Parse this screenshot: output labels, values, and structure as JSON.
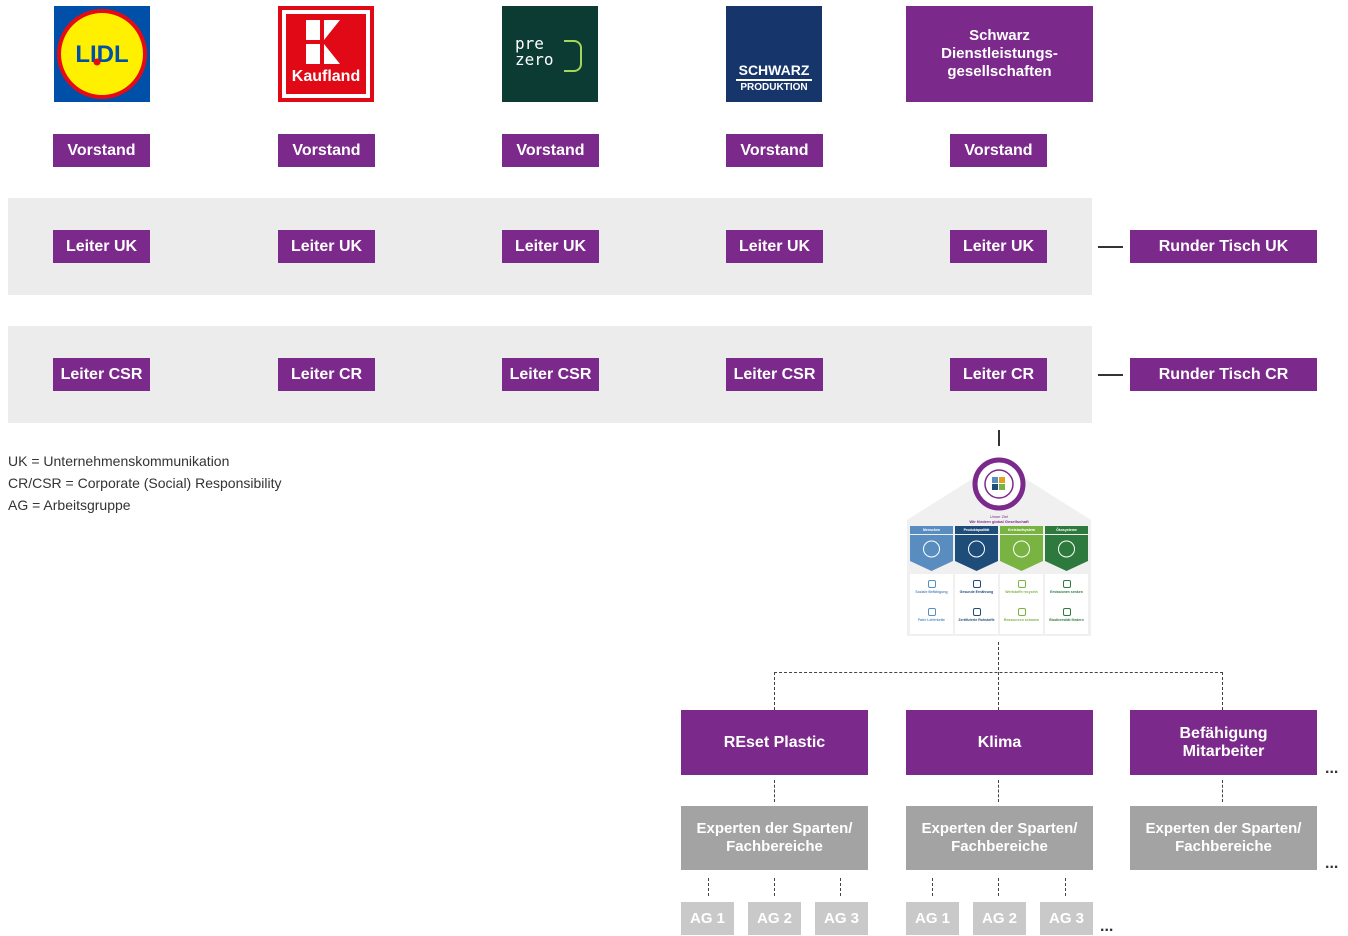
{
  "logos": {
    "lidl": {
      "text": "LIDL",
      "colors": {
        "bg": "#0050aa",
        "circle": "#fff000",
        "ring": "#e60a14"
      }
    },
    "kaufland": {
      "text": "Kaufland",
      "colors": {
        "bg": "#e10915"
      }
    },
    "prezero": {
      "text_top": "pre",
      "text_bottom": "zero",
      "colors": {
        "bg": "#0c3b34",
        "accent": "#a3d65c"
      }
    },
    "schwarz_produktion": {
      "text_top": "SCHWARZ",
      "text_bottom": "PRODUKTION",
      "colors": {
        "bg": "#16366b"
      }
    },
    "schwarz_dienst": {
      "text": "Schwarz Dienstleistungs-gesellschaften"
    }
  },
  "columns": [
    {
      "board": "Vorstand",
      "uk": "Leiter UK",
      "cr": "Leiter CSR"
    },
    {
      "board": "Vorstand",
      "uk": "Leiter UK",
      "cr": "Leiter CR"
    },
    {
      "board": "Vorstand",
      "uk": "Leiter UK",
      "cr": "Leiter CSR"
    },
    {
      "board": "Vorstand",
      "uk": "Leiter UK",
      "cr": "Leiter CSR"
    },
    {
      "board": "Vorstand",
      "uk": "Leiter UK",
      "cr": "Leiter CR"
    }
  ],
  "round_tables": {
    "uk": "Runder Tisch UK",
    "cr": "Runder Tisch CR"
  },
  "legend": [
    "UK = Unternehmenskommunikation",
    "CR/CSR = Corporate (Social) Responsibility",
    "AG = Arbeitsgruppe"
  ],
  "strategy_graphic": {
    "title_line1": "Unser Ziel",
    "title_line2": "Wir fördern global Gesellschaft",
    "pillars": [
      {
        "label": "Menschen",
        "color": "#5a8dbf",
        "items": [
          "Soziale Befähigung",
          "Faire Lieferkette"
        ]
      },
      {
        "label": "Produktqualität",
        "color": "#1f4d7a",
        "items": [
          "Gesunde Ernährung",
          "Zertifizierte Rohstoffe"
        ]
      },
      {
        "label": "Kreislaufsystem",
        "color": "#79b442",
        "items": [
          "Wertstoffe recyceln",
          "Ressourcen schonen"
        ]
      },
      {
        "label": "Ökosysteme",
        "color": "#2e7a3e",
        "items": [
          "Emissionen senken",
          "Biodiversität fördern"
        ]
      }
    ]
  },
  "workstreams": [
    {
      "label": "REset Plastic",
      "experts": "Experten der Sparten/ Fachbereiche",
      "groups": [
        "AG 1",
        "AG 2",
        "AG 3"
      ]
    },
    {
      "label": "Klima",
      "experts": "Experten der Sparten/ Fachbereiche",
      "groups": [
        "AG 1",
        "AG 2",
        "AG 3"
      ]
    },
    {
      "label": "Befähigung Mitarbeiter",
      "experts": "Experten der Sparten/ Fachbereiche",
      "groups": []
    }
  ],
  "ellipsis": "..."
}
